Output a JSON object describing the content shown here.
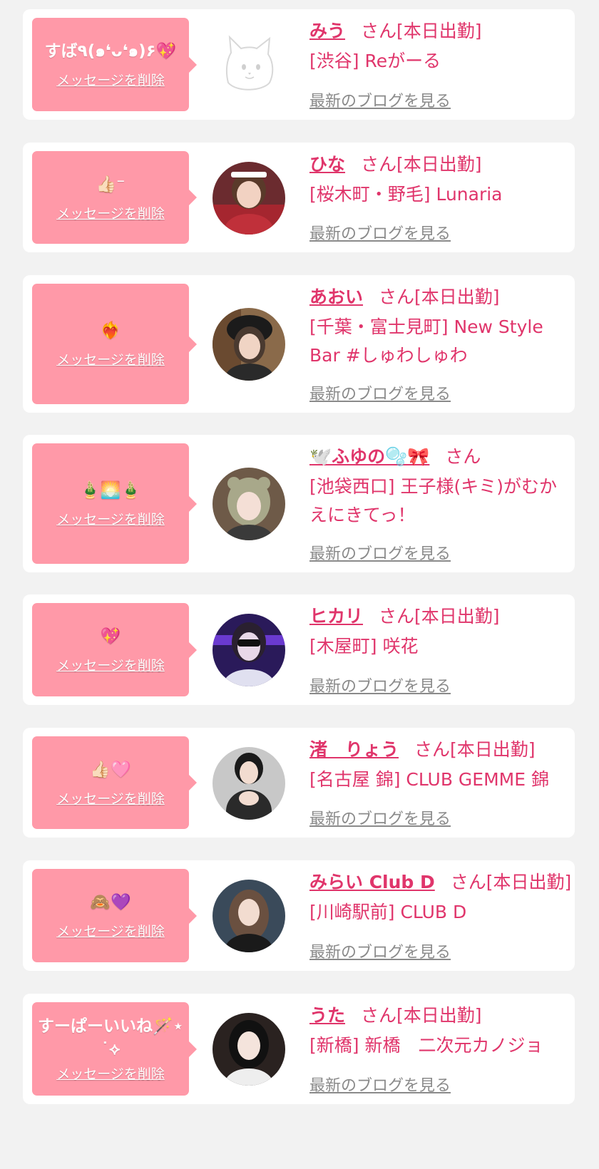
{
  "colors": {
    "accent": "#e0356b",
    "bubble": "#ff99a8",
    "card": "#ffffff",
    "background": "#f2f2f2",
    "link_gray": "#8a8a8a"
  },
  "delete_label": "メッセージを削除",
  "blog_label": "最新のブログを見る",
  "items": [
    {
      "message": "すば٩(๑❛ᴗ❛๑)۶💖",
      "name": "みう",
      "status": "さん[本日出勤]",
      "shop": "[渋谷] Reがーる",
      "avatar": "cat-placeholder-icon"
    },
    {
      "message": "👍🏻⁻",
      "name": "ひな",
      "status": "さん[本日出勤]",
      "shop": "[桜木町・野毛] Lunaria",
      "avatar": "photo"
    },
    {
      "message": "❤️‍🔥",
      "name": "あおい",
      "status": "さん[本日出勤]",
      "shop": "[千葉・富士見町] New Style Bar #しゅわしゅわ",
      "avatar": "photo"
    },
    {
      "message": "🎍🌅🎍",
      "name": "🕊️ふゆの🫧🎀",
      "status": "さん",
      "shop": "[池袋西口] 王子様(キミ)がむかえにきてっ！",
      "avatar": "photo"
    },
    {
      "message": "💖",
      "name": "ヒカリ",
      "status": "さん[本日出勤]",
      "shop": "[木屋町] 咲花",
      "avatar": "photo"
    },
    {
      "message": "👍🏻🩷",
      "name": "渚　りょう",
      "status": "さん[本日出勤]",
      "shop": "[名古屋 錦] CLUB GEMME 錦",
      "avatar": "photo"
    },
    {
      "message": "🙈💜",
      "name": "みらい Club D",
      "status": "さん[本日出勤]",
      "shop": "[川崎駅前] CLUB D",
      "avatar": "photo"
    },
    {
      "message": "すーぱーいいね🪄⋆˙⟡",
      "name": "うた",
      "status": "さん[本日出勤]",
      "shop": "[新橋] 新橋　二次元カノジョ",
      "avatar": "photo"
    }
  ]
}
